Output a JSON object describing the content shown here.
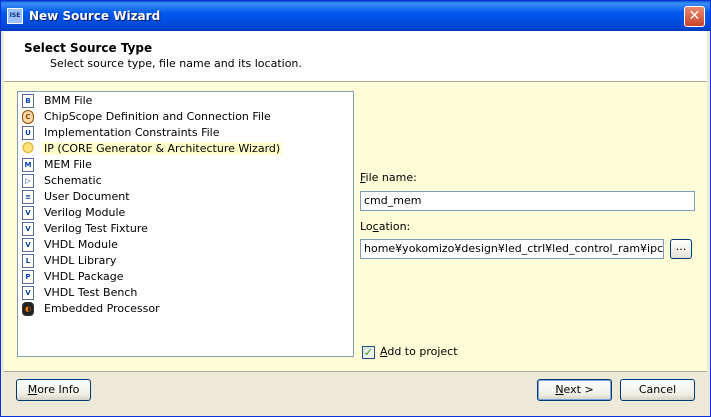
{
  "window": {
    "title": "New Source Wizard",
    "close_glyph": "✕"
  },
  "header": {
    "title": "Select Source Type",
    "subtitle": "Select source type, file name and its location."
  },
  "source_types": [
    {
      "label": "BMM File",
      "icon": "bmm-file-icon"
    },
    {
      "label": "ChipScope Definition and Connection File",
      "icon": "chipscope-icon"
    },
    {
      "label": "Implementation Constraints File",
      "icon": "constraints-file-icon"
    },
    {
      "label": "IP (CORE Generator & Architecture Wizard)",
      "icon": "ip-core-icon",
      "selected": true
    },
    {
      "label": "MEM File",
      "icon": "mem-file-icon"
    },
    {
      "label": "Schematic",
      "icon": "schematic-icon"
    },
    {
      "label": "User Document",
      "icon": "user-document-icon"
    },
    {
      "label": "Verilog Module",
      "icon": "verilog-module-icon"
    },
    {
      "label": "Verilog Test Fixture",
      "icon": "verilog-test-fixture-icon"
    },
    {
      "label": "VHDL Module",
      "icon": "vhdl-module-icon"
    },
    {
      "label": "VHDL Library",
      "icon": "vhdl-library-icon"
    },
    {
      "label": "VHDL Package",
      "icon": "vhdl-package-icon"
    },
    {
      "label": "VHDL Test Bench",
      "icon": "vhdl-test-bench-icon"
    },
    {
      "label": "Embedded Processor",
      "icon": "embedded-processor-icon"
    }
  ],
  "file_name": {
    "label_mnemonic": "F",
    "label_rest": "ile name:",
    "value": "cmd_mem"
  },
  "location": {
    "label_start": "Lo",
    "label_mnemonic": "c",
    "label_rest": "ation:",
    "value": "home¥yokomizo¥design¥led_ctrl¥led_control_ram¥ipcore_dir",
    "browse_label": "..."
  },
  "add_to_project": {
    "mnemonic": "A",
    "rest": "dd to project",
    "checked": true,
    "check_glyph": "✓"
  },
  "buttons": {
    "more_info_mnemonic": "M",
    "more_info_rest": "ore Info",
    "next_mnemonic": "N",
    "next_rest": "ext >",
    "cancel": "Cancel"
  }
}
